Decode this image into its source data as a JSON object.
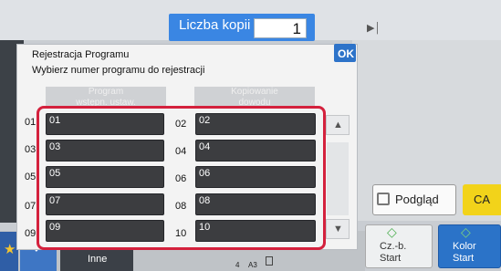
{
  "header": {
    "copies_label": "Liczba kopii",
    "copies_value": "1"
  },
  "dialog": {
    "title": "Rejestracja Programu",
    "subtitle": "Wybierz numer programu do rejestracji",
    "ok_label": "OK",
    "ghost_buttons": [
      "Program\nwstępn. ustaw.",
      "Kopiowanie\ndowodu"
    ]
  },
  "programs": [
    {
      "number": "01",
      "label": "01"
    },
    {
      "number": "02",
      "label": "02"
    },
    {
      "number": "03",
      "label": "03"
    },
    {
      "number": "04",
      "label": "04"
    },
    {
      "number": "05",
      "label": "05"
    },
    {
      "number": "06",
      "label": "06"
    },
    {
      "number": "07",
      "label": "07"
    },
    {
      "number": "08",
      "label": "08"
    },
    {
      "number": "09",
      "label": "09"
    },
    {
      "number": "10",
      "label": "10"
    }
  ],
  "right_panel": {
    "preview_label": "Podgląd",
    "ca_label": "CA",
    "start_bw_line1": "Cz.-b.",
    "start_bw_line2": "Start",
    "start_color_line1": "Kolor",
    "start_color_line2": "Start"
  },
  "bottom": {
    "inne_label": "Inne",
    "copies_mini": "4",
    "paper": "A3"
  },
  "icons": {
    "star": "star-icon",
    "check": "check-icon",
    "scroll_up": "scroll-up-icon",
    "scroll_down": "scroll-down-icon"
  },
  "colors": {
    "highlight": "#d4213d",
    "accent": "#2d73c9",
    "ca": "#f2d31a"
  }
}
